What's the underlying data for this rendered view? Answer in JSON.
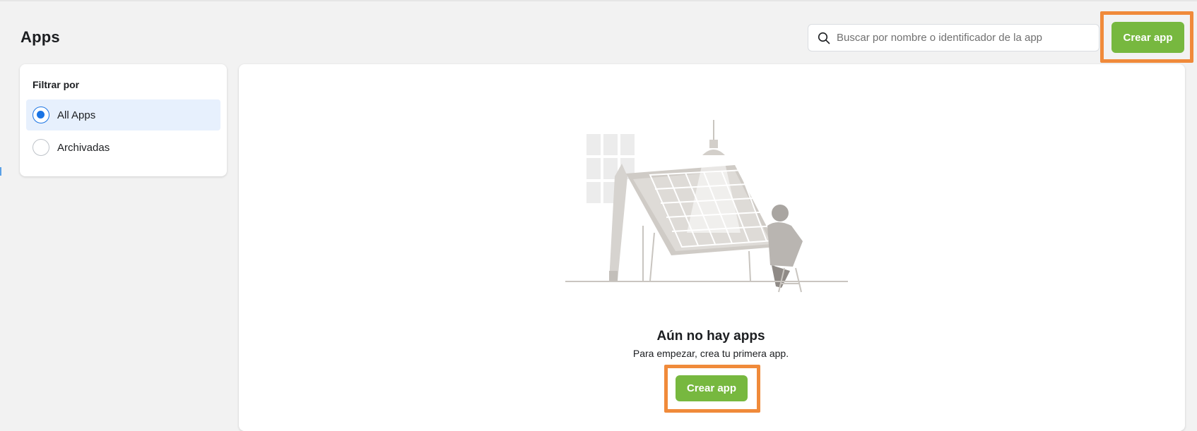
{
  "header": {
    "title": "Apps",
    "search": {
      "placeholder": "Buscar por nombre o identificador de la app",
      "value": "",
      "icon": "search-icon"
    },
    "create_button_label": "Crear app"
  },
  "filters": {
    "title": "Filtrar por",
    "options": [
      {
        "label": "All Apps",
        "selected": true
      },
      {
        "label": "Archivadas",
        "selected": false
      }
    ]
  },
  "empty_state": {
    "title": "Aún no hay apps",
    "subtitle": "Para empezar, crea tu primera app.",
    "button_label": "Crear app"
  },
  "colors": {
    "accent_green": "#77b83f",
    "highlight_orange": "#f08a3a",
    "radio_blue": "#1b74e4",
    "selected_bg": "#e7f0fd",
    "page_bg": "#f2f2f2"
  }
}
